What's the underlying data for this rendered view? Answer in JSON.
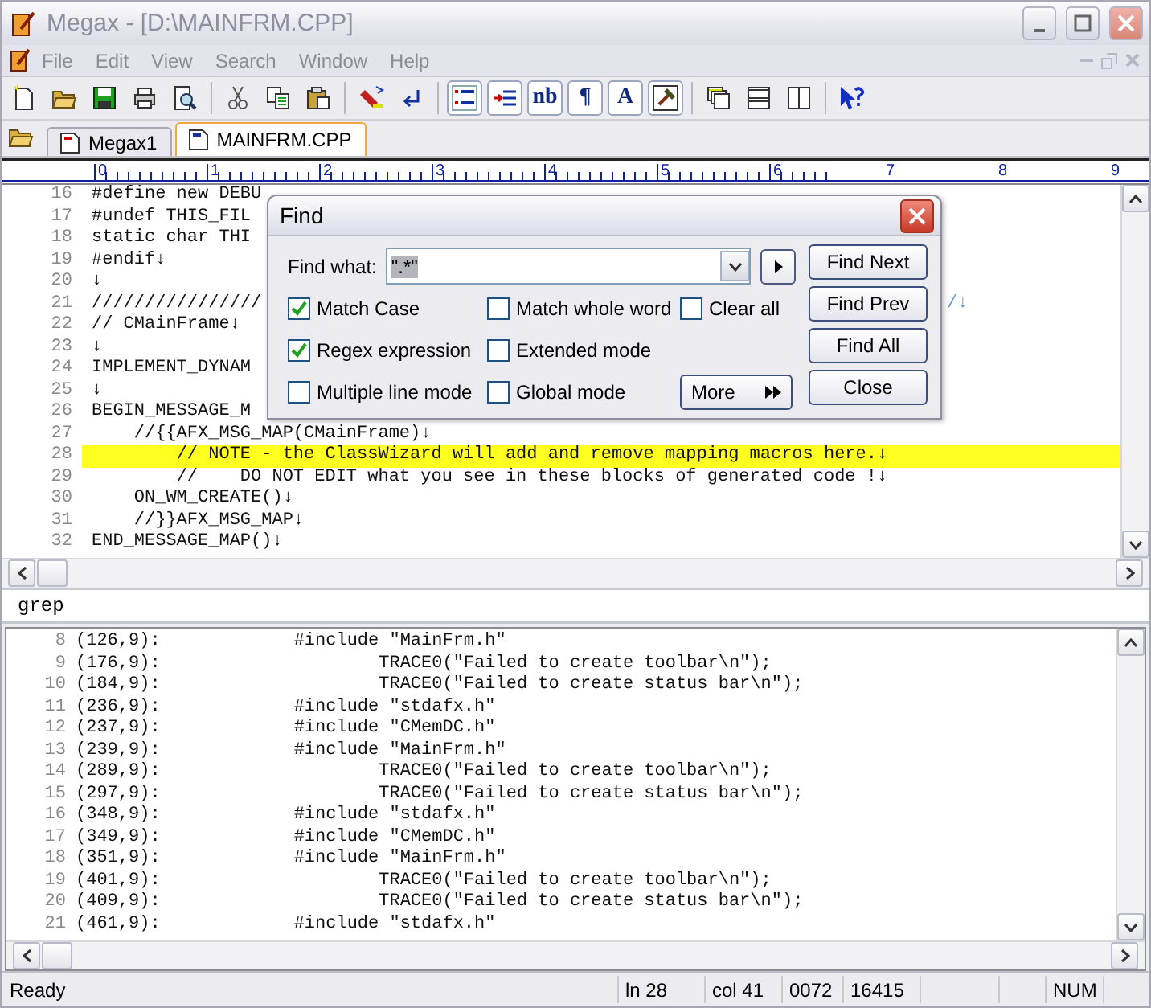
{
  "window": {
    "title": "Megax - [D:\\MAINFRM.CPP]"
  },
  "menu": [
    "File",
    "Edit",
    "View",
    "Search",
    "Window",
    "Help"
  ],
  "toolbar": [
    {
      "kind": "icon"
    },
    {
      "kind": "icon"
    },
    {
      "kind": "icon"
    },
    {
      "kind": "icon"
    },
    {
      "kind": "icon"
    },
    {
      "kind": "separator"
    },
    {
      "kind": "icon"
    },
    {
      "kind": "icon"
    },
    {
      "kind": "icon"
    },
    {
      "kind": "separator"
    },
    {
      "kind": "icon"
    },
    {
      "kind": "icon"
    },
    {
      "kind": "separator"
    },
    {
      "kind": "icon"
    },
    {
      "kind": "icon"
    },
    {
      "kind": "text",
      "label": "nb"
    },
    {
      "kind": "text",
      "label": "¶"
    },
    {
      "kind": "text",
      "label": "A"
    },
    {
      "kind": "icon"
    },
    {
      "kind": "separator"
    },
    {
      "kind": "icon"
    },
    {
      "kind": "icon"
    },
    {
      "kind": "icon"
    },
    {
      "kind": "separator"
    },
    {
      "kind": "icon"
    }
  ],
  "doc_tabs": [
    {
      "label": "Megax1",
      "selected": false
    },
    {
      "label": "MAINFRM.CPP",
      "selected": true
    }
  ],
  "ruler": {
    "marks": [
      "0",
      "1",
      "2",
      "3",
      "4",
      "5",
      "6",
      "7",
      "8",
      "9"
    ]
  },
  "editor": {
    "lines": [
      {
        "number": "16",
        "text": "#define new DEBU",
        "highlighted": false
      },
      {
        "number": "17",
        "text": "#undef THIS_FIL",
        "highlighted": false
      },
      {
        "number": "18",
        "text": "static char THI",
        "highlighted": false
      },
      {
        "number": "19",
        "text": "#endif↓",
        "highlighted": false
      },
      {
        "number": "20",
        "text": "↓",
        "highlighted": false
      },
      {
        "number": "21",
        "text": "////////////////",
        "tail": "/↓",
        "highlighted": false
      },
      {
        "number": "22",
        "text": "// CMainFrame↓",
        "highlighted": false
      },
      {
        "number": "23",
        "text": "↓",
        "highlighted": false
      },
      {
        "number": "24",
        "text": "IMPLEMENT_DYNAM",
        "highlighted": false
      },
      {
        "number": "25",
        "text": "↓",
        "highlighted": false
      },
      {
        "number": "26",
        "text": "BEGIN_MESSAGE_M",
        "highlighted": false
      },
      {
        "number": "27",
        "text": "\t//{{AFX_MSG_MAP(CMainFrame)↓",
        "highlighted": false
      },
      {
        "number": "28",
        "text": "\t\t// NOTE - the ClassWizard will add and remove mapping macros here.↓",
        "highlighted": true
      },
      {
        "number": "29",
        "text": "\t\t//    DO NOT EDIT what you see in these blocks of generated code !↓",
        "highlighted": false
      },
      {
        "number": "30",
        "text": "\tON_WM_CREATE()↓",
        "highlighted": false
      },
      {
        "number": "31",
        "text": "\t//}}AFX_MSG_MAP↓",
        "highlighted": false
      },
      {
        "number": "32",
        "text": "END_MESSAGE_MAP()↓",
        "highlighted": false
      }
    ]
  },
  "find_dialog": {
    "title": "Find",
    "find_label": "Find what:",
    "find_value": "\".*\"",
    "options": [
      {
        "label": "Match Case",
        "checked": true
      },
      {
        "label": "Match whole word",
        "checked": false
      },
      {
        "label": "Clear all",
        "checked": false
      },
      {
        "label": "Regex expression",
        "checked": true
      },
      {
        "label": "Extended mode",
        "checked": false
      },
      {
        "label": "Multiple line mode",
        "checked": false
      },
      {
        "label": "Global mode",
        "checked": false
      }
    ],
    "more_button": "More",
    "buttons": [
      "Find Next",
      "Find Prev",
      "Find All",
      "Close"
    ]
  },
  "output_panel": {
    "title": "grep",
    "lines": [
      {
        "number": "8",
        "location": "(126,9):",
        "text": "\t#include \"MainFrm.h\""
      },
      {
        "number": "9",
        "location": "(176,9):",
        "text": "\t\tTRACE0(\"Failed to create toolbar\\n\");"
      },
      {
        "number": "10",
        "location": "(184,9):",
        "text": "\t\tTRACE0(\"Failed to create status bar\\n\");"
      },
      {
        "number": "11",
        "location": "(236,9):",
        "text": "\t#include \"stdafx.h\""
      },
      {
        "number": "12",
        "location": "(237,9):",
        "text": "\t#include \"CMemDC.h\""
      },
      {
        "number": "13",
        "location": "(239,9):",
        "text": "\t#include \"MainFrm.h\""
      },
      {
        "number": "14",
        "location": "(289,9):",
        "text": "\t\tTRACE0(\"Failed to create toolbar\\n\");"
      },
      {
        "number": "15",
        "location": "(297,9):",
        "text": "\t\tTRACE0(\"Failed to create status bar\\n\");"
      },
      {
        "number": "16",
        "location": "(348,9):",
        "text": "\t#include \"stdafx.h\""
      },
      {
        "number": "17",
        "location": "(349,9):",
        "text": "\t#include \"CMemDC.h\""
      },
      {
        "number": "18",
        "location": "(351,9):",
        "text": "\t#include \"MainFrm.h\""
      },
      {
        "number": "19",
        "location": "(401,9):",
        "text": "\t\tTRACE0(\"Failed to create toolbar\\n\");"
      },
      {
        "number": "20",
        "location": "(409,9):",
        "text": "\t\tTRACE0(\"Failed to create status bar\\n\");"
      },
      {
        "number": "21",
        "location": "(461,9):",
        "text": "\t#include \"stdafx.h\""
      }
    ]
  },
  "status_bar": [
    "Ready",
    "ln 28",
    "col 41",
    "0072",
    "16415",
    "NUM"
  ]
}
